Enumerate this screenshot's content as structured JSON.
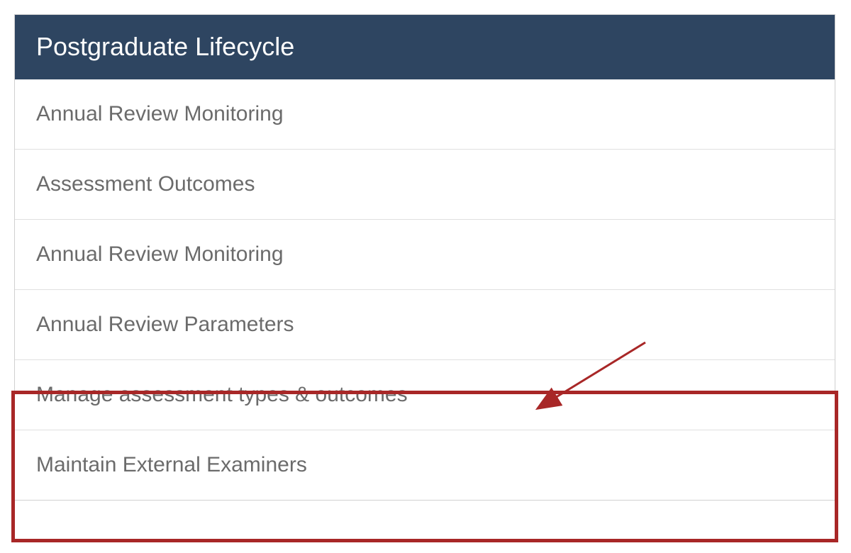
{
  "panel": {
    "title": "Postgraduate Lifecycle",
    "items": [
      {
        "label": "Annual Review Monitoring"
      },
      {
        "label": "Assessment Outcomes"
      },
      {
        "label": "Annual Review Monitoring"
      },
      {
        "label": "Annual Review Parameters"
      },
      {
        "label": "Manage assessment types & outcomes"
      },
      {
        "label": "Maintain External Examiners"
      }
    ]
  },
  "annotation": {
    "highlight_color": "#a82727",
    "arrow_color": "#a82727"
  }
}
